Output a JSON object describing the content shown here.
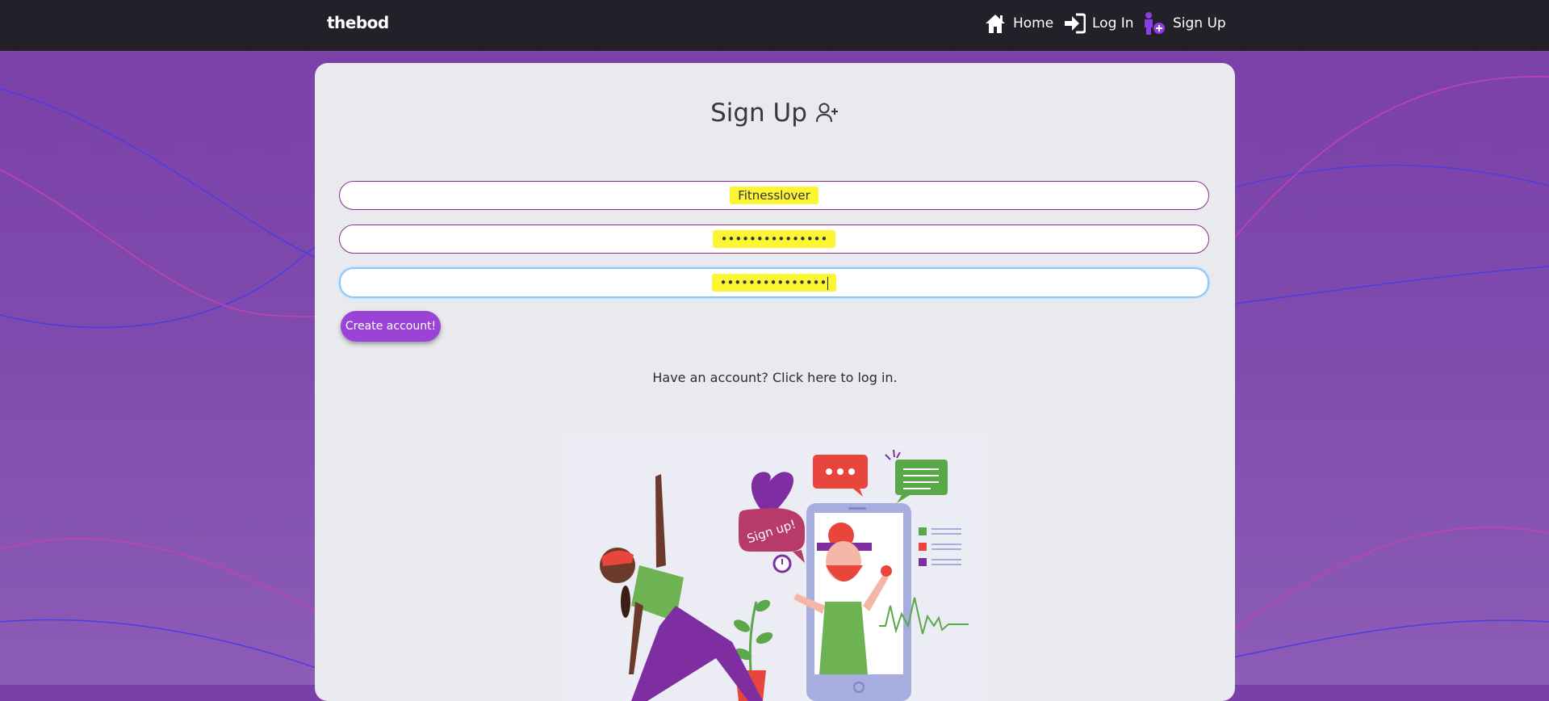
{
  "nav": {
    "brand": "thebod",
    "home_label": "Home",
    "login_label": "Log In",
    "signup_label": "Sign Up"
  },
  "form": {
    "title": "Sign Up",
    "username_value": "Fitnesslover",
    "password_value": "•••••••••••••••",
    "confirm_password_value": "•••••••••••••••",
    "create_button_label": "Create account!",
    "login_prompt": "Have an account? Click here to log in."
  },
  "illustration": {
    "speech_text": "Sign up!"
  },
  "colors": {
    "nav_bg": "#222129",
    "page_bg": "#7a3fa8",
    "card_bg": "#e8eaee",
    "accent": "#9a43d6",
    "highlight": "#fbf631",
    "field_border": "#8a2d98"
  },
  "icons": [
    "house-icon",
    "login-arrow-icon",
    "person-add-icon",
    "user-plus-icon"
  ]
}
